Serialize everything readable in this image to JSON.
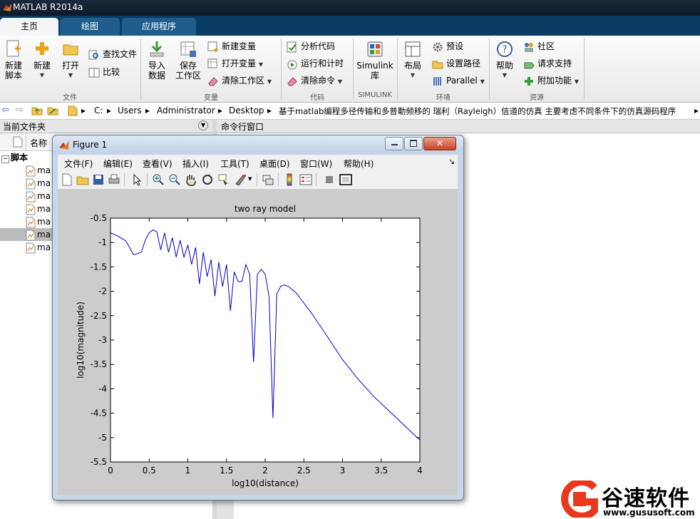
{
  "app": {
    "title": "MATLAB R2014a"
  },
  "tabs": [
    {
      "label": "主页"
    },
    {
      "label": "绘图"
    },
    {
      "label": "应用程序"
    }
  ],
  "ribbon": {
    "file": {
      "group": "文件",
      "new_script": [
        "新建",
        "脚本"
      ],
      "new": "新建",
      "open": "打开",
      "find_files": "查找文件",
      "compare": "比较"
    },
    "variable": {
      "group": "变量",
      "import": [
        "导入",
        "数据"
      ],
      "save": [
        "保存",
        "工作区"
      ],
      "new_var": "新建变量",
      "open_var": "打开变量",
      "clear_ws": "清除工作区"
    },
    "code": {
      "group": "代码",
      "analyze": "分析代码",
      "run_time": "运行和计时",
      "clear_cmd": "清除命令"
    },
    "simulink": {
      "group": "SIMULINK",
      "lib": [
        "Simulink",
        "库"
      ]
    },
    "env": {
      "group": "环境",
      "layout": "布局",
      "pref": "预设",
      "setpath": "设置路径",
      "parallel": "Parallel"
    },
    "res": {
      "group": "资源",
      "help": "帮助",
      "community": "社区",
      "support": "请求支持",
      "addons": "附加功能"
    }
  },
  "address": {
    "parts": [
      "C:",
      "Users",
      "Administrator",
      "Desktop",
      "基于matlab编程多径传输和多普勒频移的 瑞利（Rayleigh）信道的仿真 主要考虑不同条件下的仿真源码程序"
    ]
  },
  "left_panel": {
    "title": "当前文件夹",
    "col_name": "名称",
    "folder": "脚本",
    "files": [
      "ma",
      "ma",
      "ma",
      "ma",
      "ma",
      "ma",
      "ma"
    ]
  },
  "right_panel": {
    "title": "命令行窗口"
  },
  "figure": {
    "title": "Figure 1",
    "menu": [
      "文件(F)",
      "编辑(E)",
      "查看(V)",
      "插入(I)",
      "工具(T)",
      "桌面(D)",
      "窗口(W)",
      "帮助(H)"
    ]
  },
  "chart_data": {
    "type": "line",
    "title": "two ray model",
    "xlabel": "log10(distance)",
    "ylabel": "log10(magnitude)",
    "xlim": [
      0,
      4
    ],
    "ylim": [
      -5.5,
      -0.5
    ],
    "xticks": [
      "0",
      "0.5",
      "1",
      "1.5",
      "2",
      "2.5",
      "3",
      "3.5",
      "4"
    ],
    "yticks": [
      "-0.5",
      "-1",
      "-1.5",
      "-2",
      "-2.5",
      "-3",
      "-3.5",
      "-4",
      "-4.5",
      "-5",
      "-5.5"
    ],
    "grid": false,
    "series": [
      {
        "color": "#0000cc",
        "x": [
          0,
          0.1,
          0.2,
          0.3,
          0.4,
          0.45,
          0.5,
          0.55,
          0.6,
          0.65,
          0.7,
          0.75,
          0.8,
          0.85,
          0.9,
          0.95,
          1.0,
          1.05,
          1.1,
          1.15,
          1.2,
          1.25,
          1.3,
          1.35,
          1.4,
          1.45,
          1.5,
          1.55,
          1.6,
          1.65,
          1.7,
          1.75,
          1.8,
          1.85,
          1.9,
          1.95,
          2.0,
          2.05,
          2.1,
          2.15,
          2.2,
          2.25,
          2.3,
          2.4,
          2.6,
          2.8,
          3.0,
          3.2,
          3.4,
          3.6,
          3.8,
          4.0
        ],
        "y": [
          -0.8,
          -0.87,
          -0.97,
          -1.25,
          -1.2,
          -0.95,
          -0.8,
          -0.74,
          -0.78,
          -1.15,
          -0.8,
          -1.2,
          -0.9,
          -1.3,
          -0.95,
          -1.3,
          -1.05,
          -1.45,
          -1.1,
          -1.85,
          -1.2,
          -1.7,
          -1.35,
          -2.1,
          -1.4,
          -1.9,
          -1.45,
          -2.4,
          -1.6,
          -1.8,
          -1.8,
          -1.45,
          -1.65,
          -3.45,
          -1.65,
          -1.55,
          -1.65,
          -2.1,
          -4.6,
          -2.05,
          -1.9,
          -1.87,
          -1.9,
          -2.03,
          -2.45,
          -2.92,
          -3.4,
          -3.8,
          -4.15,
          -4.45,
          -4.75,
          -5.05
        ]
      }
    ]
  },
  "watermark": {
    "name": "谷速软件",
    "url": "www.gususoft.com"
  },
  "colors": {
    "tabbar": "#0a3b63",
    "accent": "#e8391f",
    "line": "#0000cc"
  }
}
